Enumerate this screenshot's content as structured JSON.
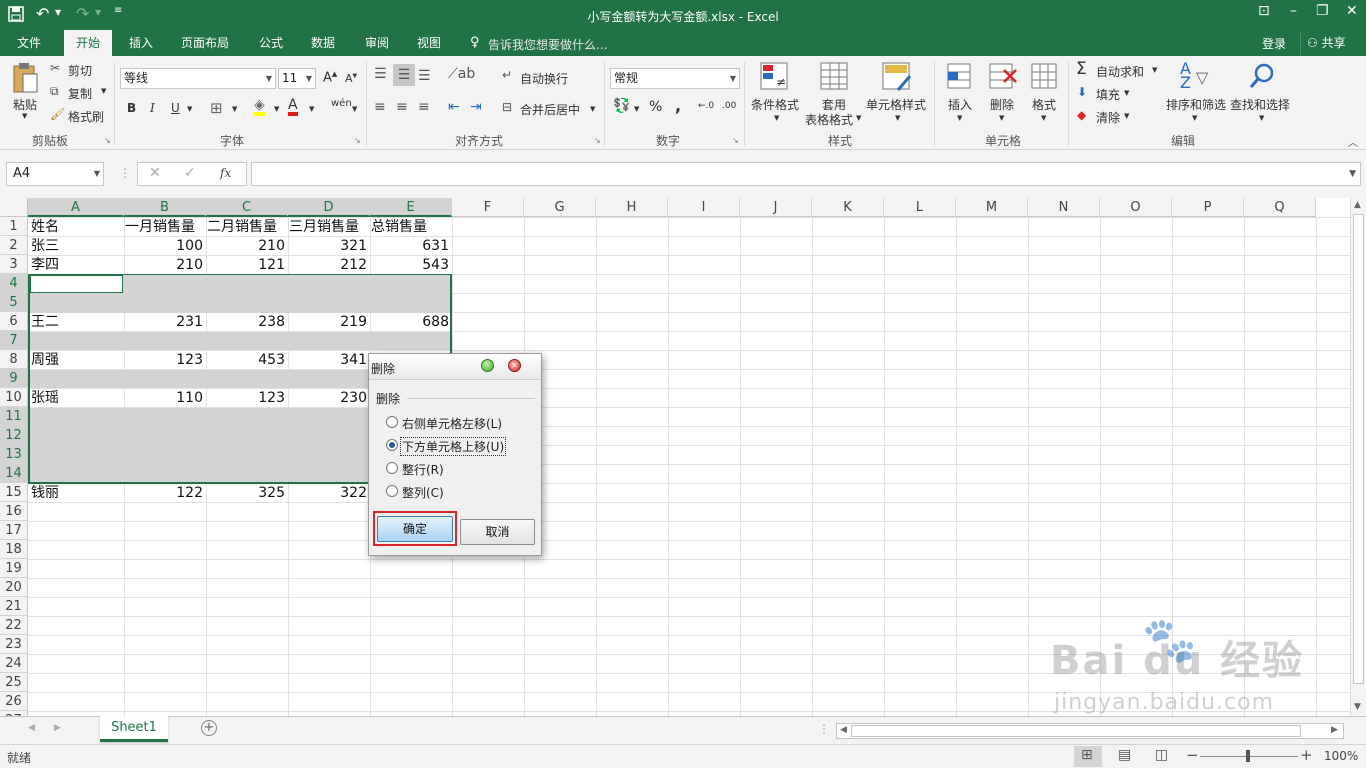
{
  "window": {
    "title": "小写金额转为大写金额.xlsx - Excel"
  },
  "tabs": [
    "文件",
    "开始",
    "插入",
    "页面布局",
    "公式",
    "数据",
    "审阅",
    "视图"
  ],
  "tell_me": "告诉我您想要做什么...",
  "account": {
    "login": "登录",
    "share": "共享"
  },
  "ribbon": {
    "clipboard": {
      "paste": "粘贴",
      "cut": "剪切",
      "copy": "复制",
      "format_painter": "格式刷",
      "group": "剪贴板"
    },
    "font": {
      "name": "等线",
      "size": "11",
      "bold": "B",
      "italic": "I",
      "underline": "U",
      "phonetic": "wén",
      "group": "字体"
    },
    "alignment": {
      "wrap": "自动换行",
      "merge": "合并后居中",
      "group": "对齐方式"
    },
    "number": {
      "format": "常规",
      "percent": "%",
      "comma": ",",
      "group": "数字"
    },
    "styles": {
      "conditional": "条件格式",
      "table_format_1": "套用",
      "table_format_2": "表格格式",
      "cell_styles": "单元格样式",
      "group": "样式"
    },
    "cells": {
      "insert": "插入",
      "delete": "删除",
      "format": "格式",
      "group": "单元格"
    },
    "editing": {
      "autosum": "自动求和",
      "fill": "填充",
      "clear": "清除",
      "sort": "排序和筛选",
      "find": "查找和选择",
      "group": "编辑"
    }
  },
  "formula_bar": {
    "name_box": "A4",
    "fx": "fx",
    "value": ""
  },
  "columns": [
    "A",
    "B",
    "C",
    "D",
    "E",
    "F",
    "G",
    "H",
    "I",
    "J",
    "K",
    "L",
    "M",
    "N",
    "O",
    "P",
    "Q"
  ],
  "rows": [
    "1",
    "2",
    "3",
    "4",
    "5",
    "6",
    "7",
    "8",
    "9",
    "10",
    "11",
    "12",
    "13",
    "14",
    "15",
    "16",
    "17",
    "18",
    "19",
    "20",
    "21",
    "22",
    "23",
    "24",
    "25",
    "26",
    "27"
  ],
  "table": {
    "header": [
      "姓名",
      "一月销售量",
      "二月销售量",
      "三月销售量",
      "总销售量"
    ],
    "row2": [
      "张三",
      "100",
      "210",
      "321",
      "631"
    ],
    "row3": [
      "李四",
      "210",
      "121",
      "212",
      "543"
    ],
    "row6": [
      "王二",
      "231",
      "238",
      "219",
      "688"
    ],
    "row8": [
      "周强",
      "123",
      "453",
      "341"
    ],
    "row10": [
      "张瑶",
      "110",
      "123",
      "230"
    ],
    "row15": [
      "钱丽",
      "122",
      "325",
      "322"
    ]
  },
  "dialog": {
    "title": "删除",
    "group_label": "删除",
    "options": [
      "右侧单元格左移(L)",
      "下方单元格上移(U)",
      "整行(R)",
      "整列(C)"
    ],
    "selected_option": "下方单元格上移(U)",
    "ok": "确定",
    "cancel": "取消"
  },
  "sheet_tab": "Sheet1",
  "status": {
    "ready": "就绪",
    "zoom": "100%"
  },
  "watermark": {
    "line1": "Bai du 经验",
    "line2": "jingyan.baidu.com"
  },
  "colors": {
    "brand": "#217346",
    "selection": "#d3d3d3",
    "highlight_border": "#d9262c"
  }
}
